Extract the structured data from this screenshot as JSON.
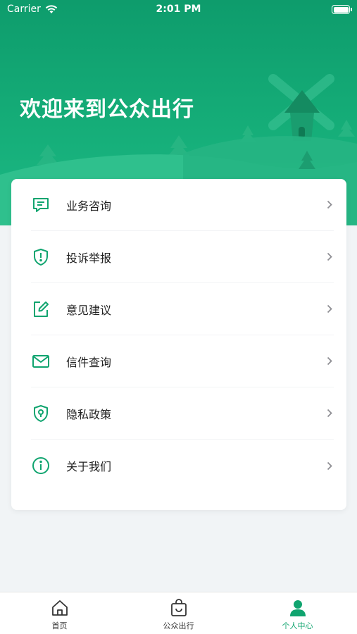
{
  "status_bar": {
    "carrier": "Carrier",
    "time": "2:01 PM"
  },
  "hero": {
    "welcome": "欢迎来到公众出行"
  },
  "menu": [
    {
      "label": "业务咨询",
      "icon": "chat-icon"
    },
    {
      "label": "投诉举报",
      "icon": "shield-alert-icon"
    },
    {
      "label": "意见建议",
      "icon": "edit-icon"
    },
    {
      "label": "信件查询",
      "icon": "mail-icon"
    },
    {
      "label": "隐私政策",
      "icon": "shield-lock-icon"
    },
    {
      "label": "关于我们",
      "icon": "info-icon"
    }
  ],
  "tabbar": {
    "items": [
      {
        "label": "首页",
        "icon": "home-icon",
        "active": false
      },
      {
        "label": "公众出行",
        "icon": "bag-icon",
        "active": false
      },
      {
        "label": "个人中心",
        "icon": "user-icon",
        "active": true
      }
    ]
  },
  "colors": {
    "accent": "#10a46f",
    "hero_top": "#0e9c6c",
    "background": "#f1f4f6"
  }
}
